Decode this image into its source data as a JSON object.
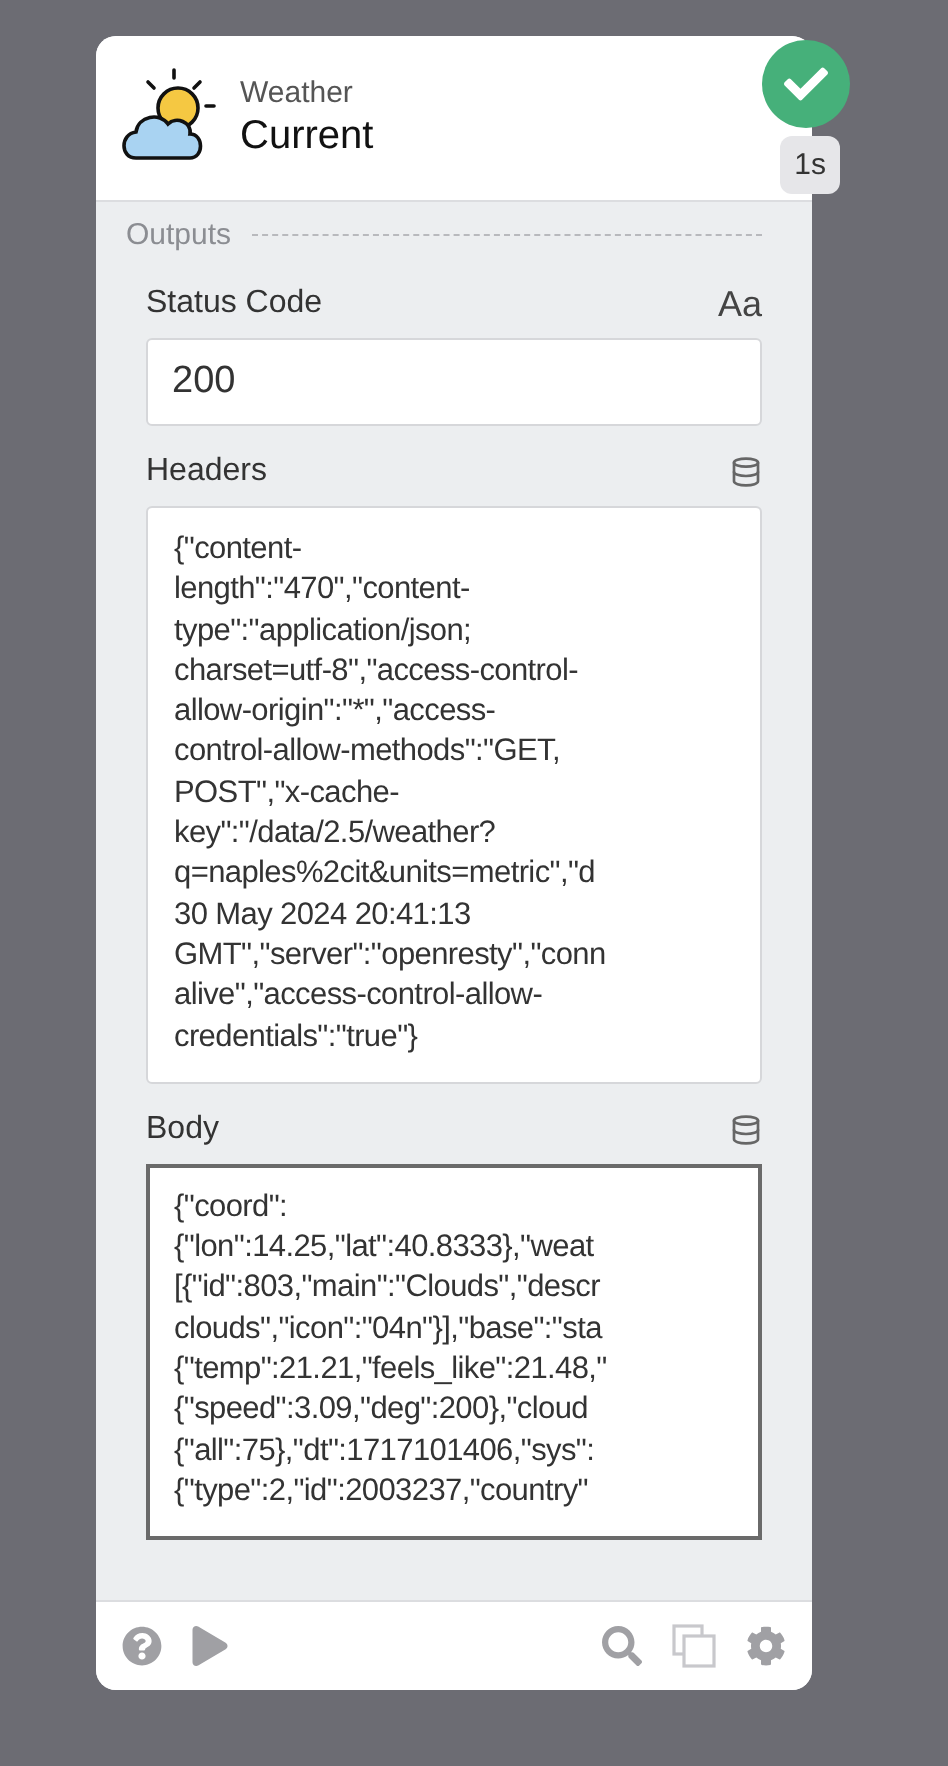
{
  "card": {
    "category": "Weather",
    "title": "Current",
    "status": {
      "ok": true,
      "duration": "1s"
    }
  },
  "outputs": {
    "label": "Outputs",
    "fields": [
      {
        "kind": "single",
        "label": "Status Code",
        "type_badge": "Aa",
        "value": "200",
        "focused": false
      },
      {
        "kind": "multi",
        "label": "Headers",
        "value": "{\"content-\nlength\":\"470\",\"content-\ntype\":\"application/json;\ncharset=utf-8\",\"access-control-\nallow-origin\":\"*\",\"access-\ncontrol-allow-methods\":\"GET,\nPOST\",\"x-cache-\nkey\":\"/data/2.5/weather?\nq=naples%2cit&units=metric\",\"d\n30 May 2024 20:41:13\nGMT\",\"server\":\"openresty\",\"conn\nalive\",\"access-control-allow-\ncredentials\":\"true\"}",
        "focused": false
      },
      {
        "kind": "multi",
        "label": "Body",
        "value": "{\"coord\":\n{\"lon\":14.25,\"lat\":40.8333},\"weat\n[{\"id\":803,\"main\":\"Clouds\",\"descr\nclouds\",\"icon\":\"04n\"}],\"base\":\"sta\n{\"temp\":21.21,\"feels_like\":21.48,\"\n{\"speed\":3.09,\"deg\":200},\"cloud\n{\"all\":75},\"dt\":1717101406,\"sys\":\n{\"type\":2,\"id\":2003237,\"country\"",
        "focused": true
      }
    ]
  }
}
